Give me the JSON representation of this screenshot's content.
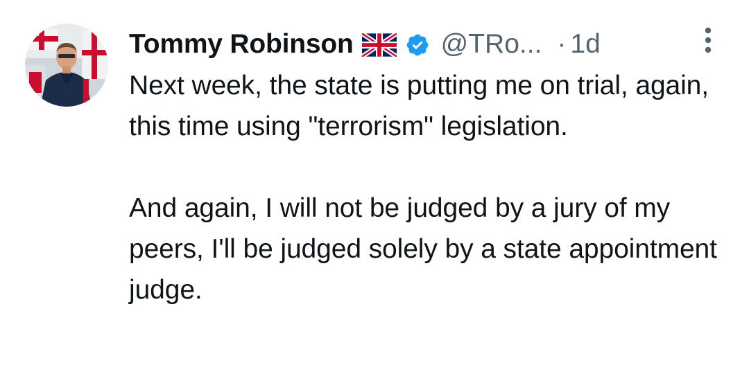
{
  "tweet": {
    "author": {
      "display_name": "Tommy Robinson",
      "flag_icon": "uk-flag-icon",
      "verified_icon": "verified-badge-icon",
      "handle": "@TRo...",
      "separator": "·",
      "timestamp": "1d"
    },
    "paragraphs": [
      "Next week, the state is putting me on trial, again, this time using \"terrorism\" legislation.",
      "And again, I will not be judged by a jury of my peers, I'll be judged solely by a state appointment judge."
    ],
    "more_icon": "more-vertical-icon"
  },
  "colors": {
    "text_primary": "#0f1419",
    "text_secondary": "#536471",
    "verified_blue": "#1d9bf0",
    "background": "#ffffff"
  }
}
